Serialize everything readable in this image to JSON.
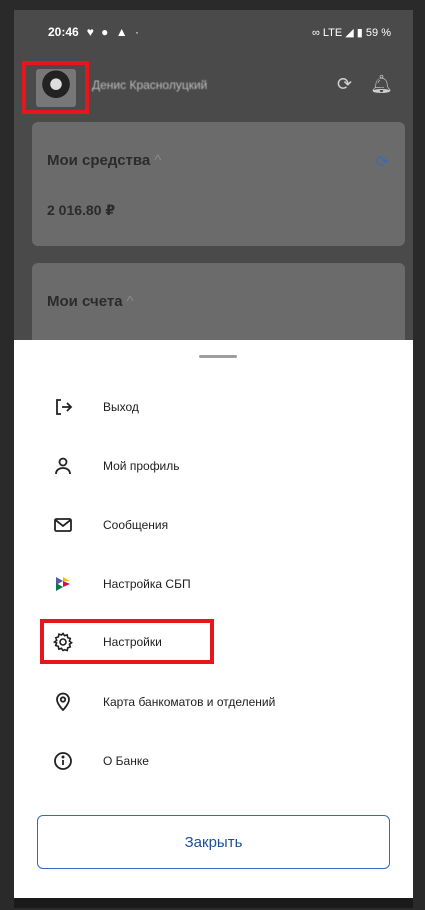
{
  "status_bar": {
    "time": "20:46",
    "left_icons": "♥ ● ▲ ·",
    "right": "∞ LTE ◢ ▮ 59 %"
  },
  "header": {
    "user_name": "Денис Краснолуцкий"
  },
  "cards": [
    {
      "title": "Мои средства",
      "amount": "2 016.80 ₽"
    },
    {
      "title": "Мои счета"
    }
  ],
  "menu": [
    {
      "icon": "logout-icon",
      "label": "Выход"
    },
    {
      "icon": "profile-icon",
      "label": "Мой профиль"
    },
    {
      "icon": "messages-icon",
      "label": "Сообщения"
    },
    {
      "icon": "sbp-icon",
      "label": "Настройка СБП"
    },
    {
      "icon": "settings-icon",
      "label": "Настройки"
    },
    {
      "icon": "location-pin-icon",
      "label": "Карта банкоматов и отделений"
    },
    {
      "icon": "info-icon",
      "label": "О Банке"
    }
  ],
  "close_button": {
    "label": "Закрыть"
  },
  "colors": {
    "highlight": "#e5161d",
    "accent": "#2f6db5",
    "sbp": [
      "#5b57a2",
      "#d90751",
      "#fab91b",
      "#0f754e"
    ]
  }
}
